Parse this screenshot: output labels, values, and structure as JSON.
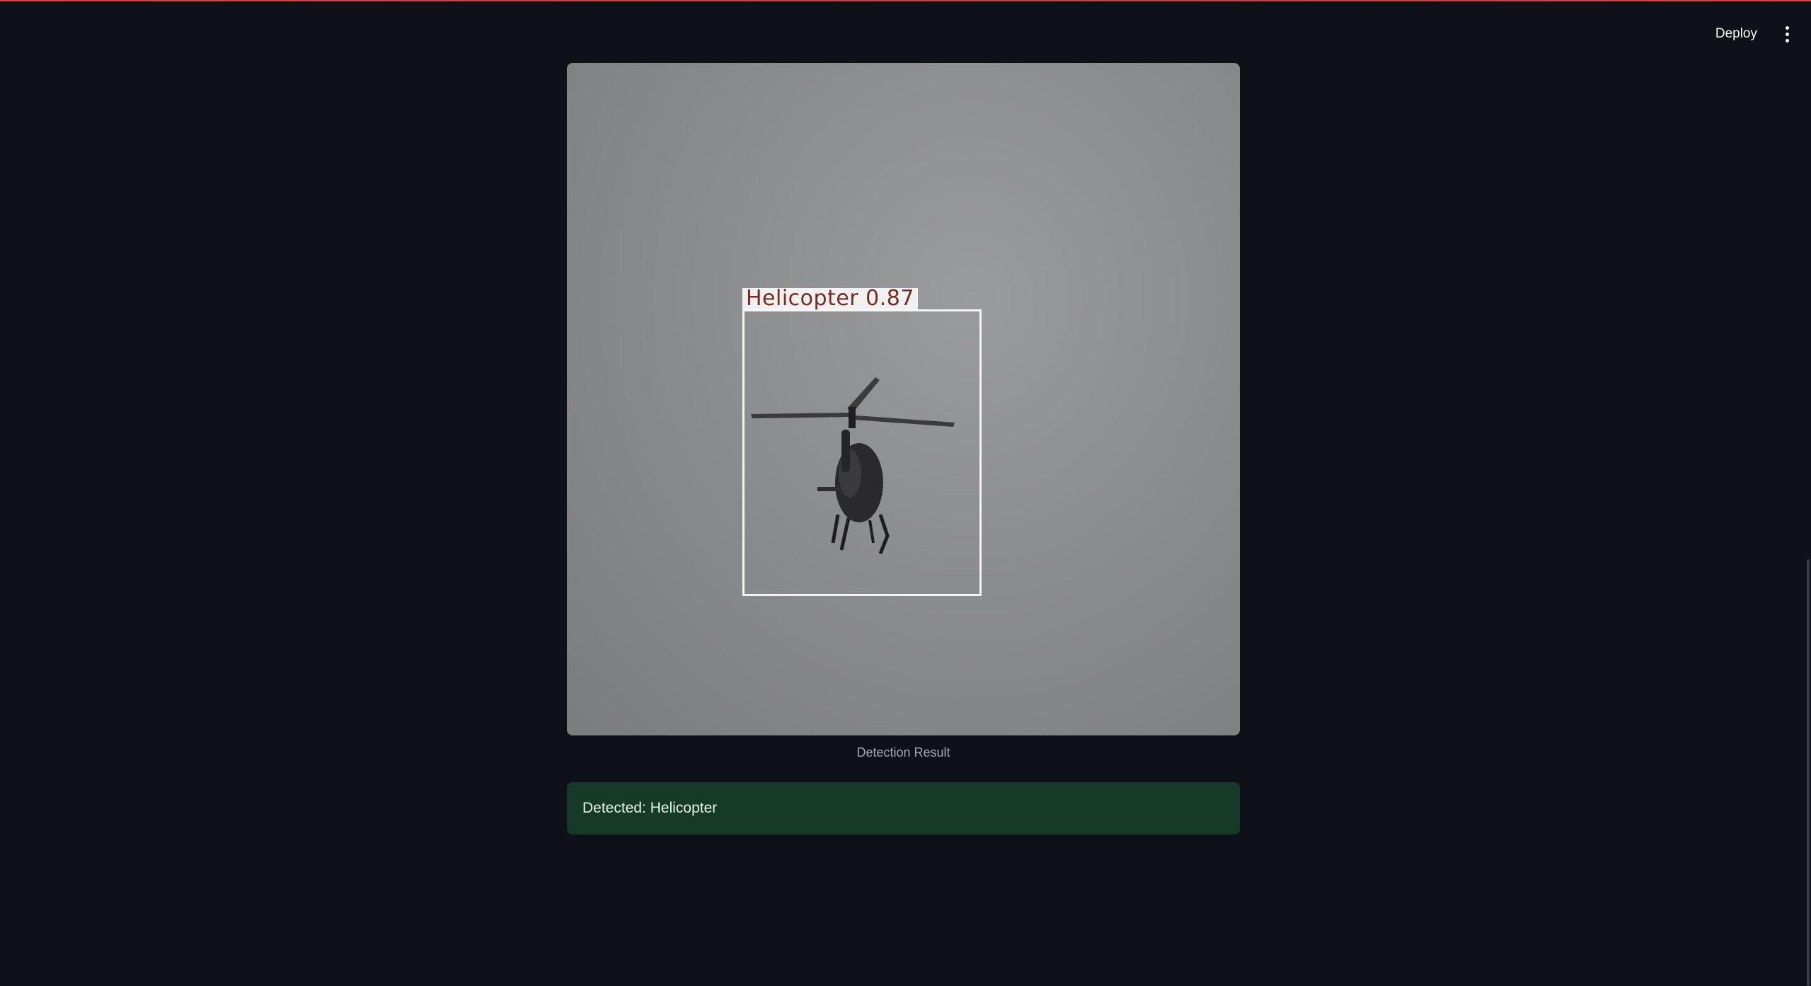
{
  "header": {
    "deploy_label": "Deploy",
    "menu_icon": "kebab-menu-icon"
  },
  "image": {
    "alt": "Helicopter in overcast sky with detection box",
    "detection": {
      "label": "Helicopter 0.87",
      "class": "Helicopter",
      "confidence": 0.87,
      "box_color": "#f4f4f4",
      "label_text_color": "#7a2a22"
    },
    "caption": "Detection Result"
  },
  "result": {
    "message": "Detected: Helicopter",
    "status": "success",
    "background": "#173928"
  },
  "theme": {
    "background": "#0e1117",
    "accent": "#ff4b4b"
  }
}
